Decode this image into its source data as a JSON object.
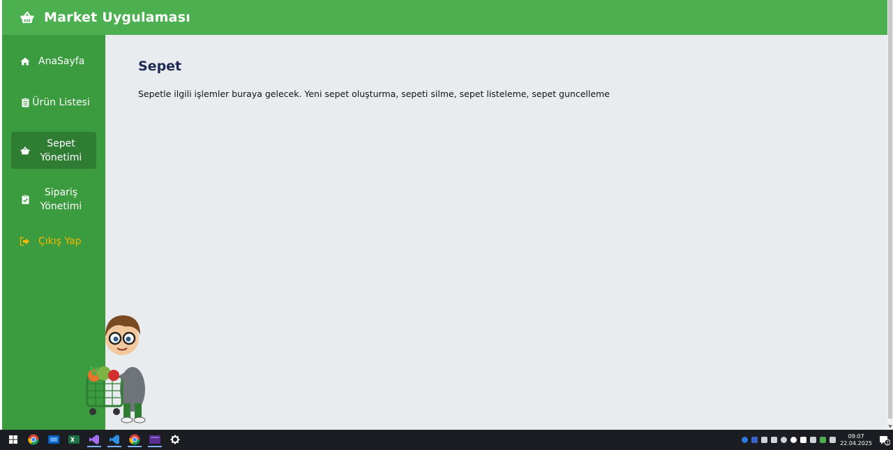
{
  "app": {
    "title": "Market Uygulaması"
  },
  "sidebar": {
    "items": [
      {
        "label": "AnaSayfa",
        "icon": "home-icon"
      },
      {
        "label": "Ürün Listesi",
        "icon": "clipboard-list-icon"
      },
      {
        "label": "Sepet Yönetimi",
        "icon": "basket-icon",
        "active": true
      },
      {
        "label": "Sipariş Yönetimi",
        "icon": "clipboard-check-icon"
      },
      {
        "label": "Çıkış Yap",
        "icon": "sign-out-icon"
      }
    ]
  },
  "main": {
    "title": "Sepet",
    "description": "Sepetle ilgili işlemler buraya gelecek. Yeni sepet oluşturma, sepeti silme, sepet listeleme, sepet guncelleme"
  },
  "taskbar": {
    "apps": [
      "windows-start-icon",
      "chrome-icon",
      "outlook-icon",
      "excel-icon",
      "visual-studio-icon",
      "vscode-icon",
      "chrome-profile-icon",
      "terminal-icon",
      "settings-icon"
    ],
    "time": "09:07",
    "date": "22.04.2025",
    "notification_count": "2"
  },
  "colors": {
    "header": "#4caf50",
    "sidebar": "#3b9b3f",
    "active": "#2e7d32",
    "logout": "#f5b800",
    "title": "#1f2a55",
    "content_bg": "#e9ecef"
  }
}
